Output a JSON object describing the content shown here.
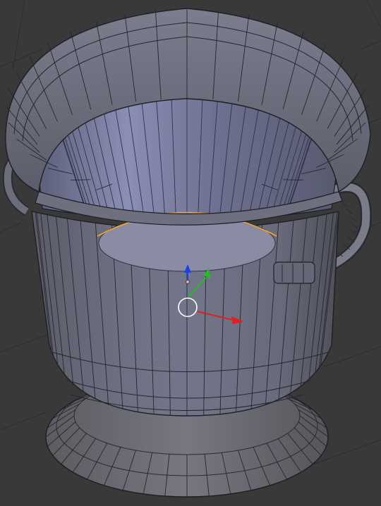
{
  "viewport": {
    "background": "#393939",
    "grid_line_color": "#2e2e2e",
    "object": "pot-mesh",
    "mode": "edit",
    "wireframe_color": "#1e1e26",
    "selected_edge_color": "#f5a623"
  },
  "gizmo": {
    "x_axis_color": "#e02020",
    "y_axis_color": "#20c020",
    "z_axis_color": "#2040e0",
    "cursor_color": "#ffffff"
  }
}
